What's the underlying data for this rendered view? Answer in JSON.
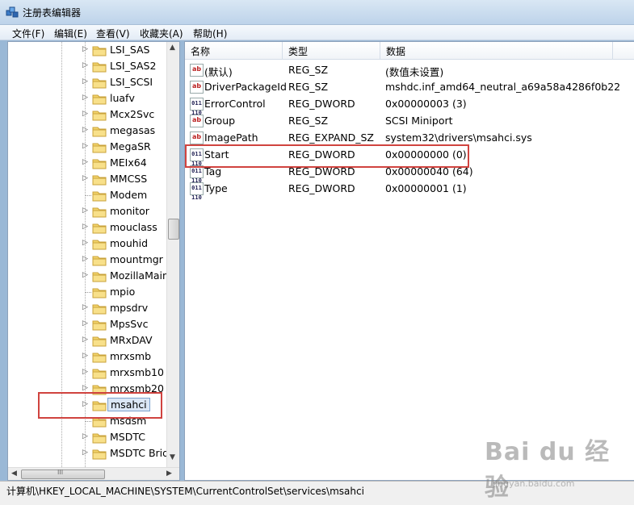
{
  "window": {
    "title": "注册表编辑器"
  },
  "menu": [
    "文件(F)",
    "编辑(E)",
    "查看(V)",
    "收藏夹(A)",
    "帮助(H)"
  ],
  "tree": {
    "items": [
      {
        "label": "LSI_SAS",
        "expander": true
      },
      {
        "label": "LSI_SAS2",
        "expander": true
      },
      {
        "label": "LSI_SCSI",
        "expander": true
      },
      {
        "label": "luafv",
        "expander": true
      },
      {
        "label": "Mcx2Svc",
        "expander": true
      },
      {
        "label": "megasas",
        "expander": true
      },
      {
        "label": "MegaSR",
        "expander": true
      },
      {
        "label": "MEIx64",
        "expander": true
      },
      {
        "label": "MMCSS",
        "expander": true
      },
      {
        "label": "Modem",
        "expander": false
      },
      {
        "label": "monitor",
        "expander": true
      },
      {
        "label": "mouclass",
        "expander": true
      },
      {
        "label": "mouhid",
        "expander": true
      },
      {
        "label": "mountmgr",
        "expander": true
      },
      {
        "label": "MozillaMain",
        "expander": true
      },
      {
        "label": "mpio",
        "expander": false
      },
      {
        "label": "mpsdrv",
        "expander": true
      },
      {
        "label": "MpsSvc",
        "expander": true
      },
      {
        "label": "MRxDAV",
        "expander": true
      },
      {
        "label": "mrxsmb",
        "expander": true
      },
      {
        "label": "mrxsmb10",
        "expander": true
      },
      {
        "label": "mrxsmb20",
        "expander": true
      },
      {
        "label": "msahci",
        "expander": true,
        "selected": true
      },
      {
        "label": "msdsm",
        "expander": false
      },
      {
        "label": "MSDTC",
        "expander": true
      },
      {
        "label": "MSDTC Brid",
        "expander": true
      }
    ]
  },
  "list": {
    "headers": {
      "name": "名称",
      "type": "类型",
      "data": "数据"
    },
    "rows": [
      {
        "icon": "string-value-icon",
        "name": "(默认)",
        "type": "REG_SZ",
        "data": "(数值未设置)"
      },
      {
        "icon": "string-value-icon",
        "name": "DriverPackageId",
        "type": "REG_SZ",
        "data": "mshdc.inf_amd64_neutral_a69a58a4286f0b22"
      },
      {
        "icon": "dword-value-icon",
        "name": "ErrorControl",
        "type": "REG_DWORD",
        "data": "0x00000003 (3)"
      },
      {
        "icon": "string-value-icon",
        "name": "Group",
        "type": "REG_SZ",
        "data": "SCSI Miniport"
      },
      {
        "icon": "string-value-icon",
        "name": "ImagePath",
        "type": "REG_EXPAND_SZ",
        "data": "system32\\drivers\\msahci.sys"
      },
      {
        "icon": "dword-value-icon",
        "name": "Start",
        "type": "REG_DWORD",
        "data": "0x00000000 (0)",
        "highlight": true
      },
      {
        "icon": "dword-value-icon",
        "name": "Tag",
        "type": "REG_DWORD",
        "data": "0x00000040 (64)"
      },
      {
        "icon": "dword-value-icon",
        "name": "Type",
        "type": "REG_DWORD",
        "data": "0x00000001 (1)"
      }
    ]
  },
  "icons": {
    "string_glyph": "ab",
    "dword_glyph": "011 110"
  },
  "scroll": {
    "h_thumb_glyph": "III"
  },
  "status": {
    "path": "计算机\\HKEY_LOCAL_MACHINE\\SYSTEM\\CurrentControlSet\\services\\msahci"
  },
  "watermark": {
    "brand": "Bai du 经验",
    "url": "jingyan.baidu.com"
  },
  "colors": {
    "highlight_box": "#d0433f",
    "selection": "#dbe7f6"
  }
}
